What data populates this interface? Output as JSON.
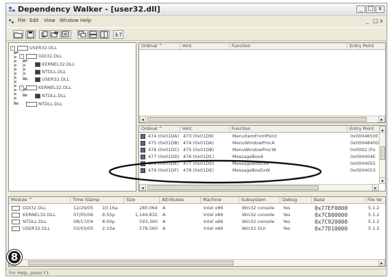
{
  "window": {
    "title": "Dependency Walker - [user32.dll]",
    "controls": {
      "minimize": "_",
      "maximize": "□",
      "close": "x"
    }
  },
  "menubar": {
    "items": [
      "File",
      "Edit",
      "View",
      "Window",
      "Help"
    ],
    "mdi_controls": [
      "_",
      "̈",
      "x"
    ]
  },
  "tree": {
    "nodes": [
      {
        "label": "USER32.DLL",
        "level": 0,
        "expander": "-"
      },
      {
        "label": "GDI32.DLL",
        "level": 1,
        "expander": "-"
      },
      {
        "label": "KERNEL32.DLL",
        "level": 2,
        "expander": ""
      },
      {
        "label": "NTDLL.DLL",
        "level": 2,
        "expander": ""
      },
      {
        "label": "USER32.DLL",
        "level": 2,
        "expander": ""
      },
      {
        "label": "KERNEL32.DLL",
        "level": 1,
        "expander": "-"
      },
      {
        "label": "NTDLL.DLL",
        "level": 2,
        "expander": ""
      },
      {
        "label": "NTDLL.DLL",
        "level": 1,
        "expander": ""
      }
    ]
  },
  "imports_pane": {
    "columns": [
      "Ordinal ^",
      "Hint",
      "Function",
      "Entry Point"
    ]
  },
  "exports_pane": {
    "columns": [
      "Ordinal ^",
      "Hint",
      "Function",
      "Entry Point"
    ],
    "rows": [
      {
        "ordinal": "474 (0x01DA)",
        "hint": "473 (0x01D9)",
        "function": "MenuItemFromPoint",
        "entry": "0x0004650E"
      },
      {
        "ordinal": "475 (0x01DB)",
        "hint": "474 (0x01DA)",
        "function": "MenuWindowProcA",
        "entry": "0x0004840D"
      },
      {
        "ordinal": "476 (0x01DC)",
        "hint": "475 (0x01DB)",
        "function": "MenuWindowProcW",
        "entry": "0x0002 (Fo"
      },
      {
        "ordinal": "477 (0x01DD)",
        "hint": "476 (0x01DC)",
        "function": "MessageBoxA",
        "entry": "0x000404E"
      },
      {
        "ordinal": "478 (0x01DE)",
        "hint": "477 (0x01DD)",
        "function": "MessageBoxExA",
        "entry": "0x0004055"
      },
      {
        "ordinal": "479 (0x01DF)",
        "hint": "478 (0x01DE)",
        "function": "MessageBoxExW",
        "entry": "0x0004053"
      }
    ]
  },
  "modules_list": {
    "columns": [
      "Module ^",
      "Time Stamp",
      "Size",
      "Attributes",
      "Machine",
      "Subsystem",
      "Debug",
      "Base",
      "File Ve"
    ],
    "rows": [
      {
        "module": "GDI32.DLL",
        "time": "12/29/05",
        "time2": "10:16a",
        "size": "280,064",
        "attr": "A",
        "machine": "Intel x86",
        "subsystem": "Win32 console",
        "debug": "Yes",
        "base": "0x77EF0000",
        "ver": "5.1.2"
      },
      {
        "module": "KERNEL32.DLL",
        "time": "07/05/06",
        "time2": "6:55p",
        "size": "1,144,832",
        "attr": "A",
        "machine": "Intel x86",
        "subsystem": "Win32 console",
        "debug": "Yes",
        "base": "0x7C800000",
        "ver": "5.1.2"
      },
      {
        "module": "NTDLL.DLL",
        "time": "08/17/04",
        "time2": "8:00p",
        "size": "593,360",
        "attr": "A",
        "machine": "Intel x86",
        "subsystem": "Win32 console",
        "debug": "Yes",
        "base": "0x7C920000",
        "ver": "5.1.2"
      },
      {
        "module": "USER32.DLL",
        "time": "03/03/05",
        "time2": "2:10a",
        "size": "578,560",
        "attr": "A",
        "machine": "Intel x86",
        "subsystem": "Win32 GUI",
        "debug": "Yes",
        "base": "0x77D10000",
        "ver": "5.1.2"
      }
    ]
  },
  "statusbar": {
    "text": "For Help, press F1"
  },
  "callout": {
    "number": "8"
  }
}
